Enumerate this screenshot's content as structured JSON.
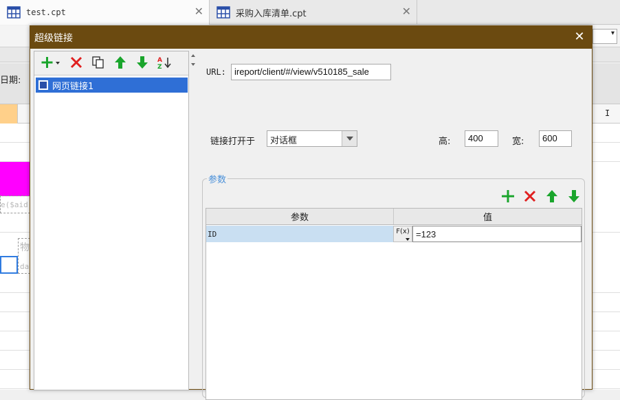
{
  "tabs": [
    {
      "label": "test.cpt",
      "active": true
    },
    {
      "label": "采购入库清单.cpt",
      "active": false
    }
  ],
  "background": {
    "date_label": "日期:",
    "column_letter": "I",
    "ghost_text_1": "e($aid",
    "ghost_text_2": "物",
    "ghost_text_3": "da"
  },
  "dialog": {
    "title": "超级链接",
    "close_symbol": "✕",
    "list_items": [
      {
        "label": "网页链接1",
        "selected": true
      }
    ],
    "url_label": "URL:",
    "url_value": "ireport/client/#/view/v510185_sale",
    "open_in_label": "链接打开于",
    "open_in_value": "对话框",
    "height_label": "高:",
    "height_value": "400",
    "width_label": "宽:",
    "width_value": "600",
    "params_group_label": "参数",
    "params_table": {
      "headers": [
        "参数",
        "值"
      ],
      "rows": [
        {
          "name": "ID",
          "fx": "F(x)",
          "value": "=123"
        }
      ]
    }
  },
  "colors": {
    "title_bar": "#6b4a10",
    "selection": "#2f6fd6",
    "add_green": "#1aa52c",
    "delete_red": "#e02020",
    "legend_blue": "#4a90d9"
  },
  "icons": [
    "add-icon",
    "dropdown-caret-icon",
    "delete-icon",
    "copy-icon",
    "move-up-icon",
    "move-down-icon",
    "sort-icon",
    "close-icon",
    "web-link-icon"
  ]
}
